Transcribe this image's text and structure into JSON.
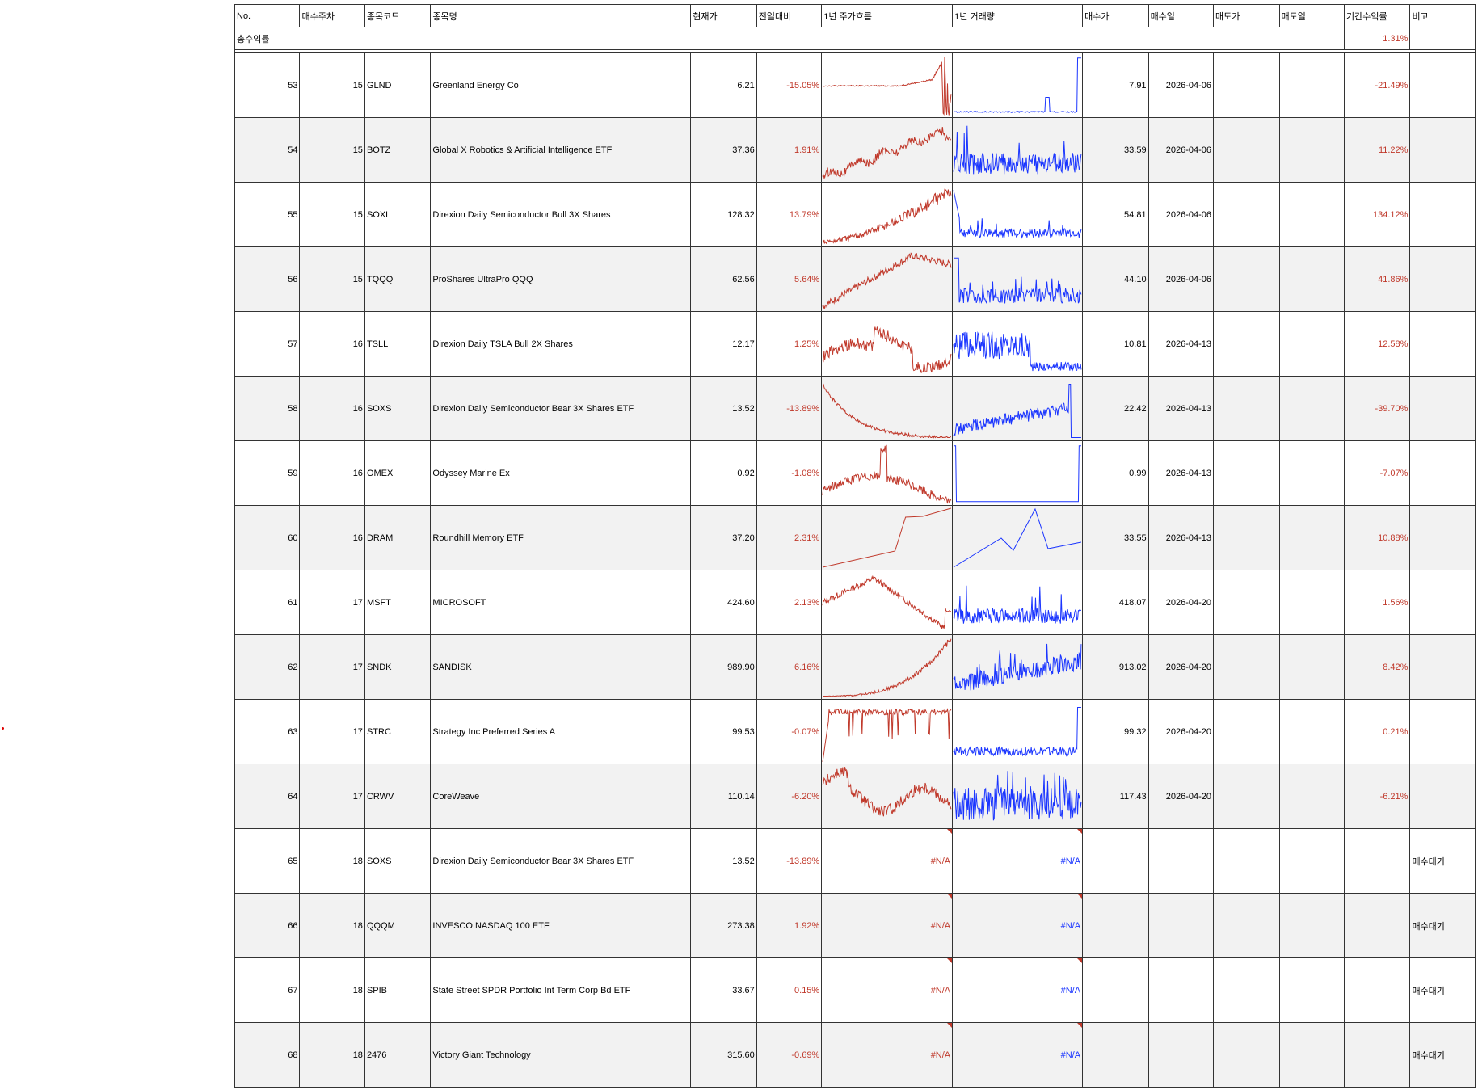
{
  "headers": [
    "No.",
    "매수주차",
    "종목코드",
    "종목명",
    "현재가",
    "전일대비",
    "1년 주가흐름",
    "1년 거래량",
    "매수가",
    "매수일",
    "매도가",
    "매도일",
    "기간수익률",
    "비고"
  ],
  "total": {
    "label": "총수익률",
    "return": "1.31%"
  },
  "colors": {
    "positive": "#c0392b",
    "negative": "#c0392b",
    "price_line": "#c0392b",
    "volume_line": "#1a35ff"
  },
  "rows": [
    {
      "no": "53",
      "week": "15",
      "code": "GLND",
      "name": "Greenland Energy Co",
      "price": "6.21",
      "change": "-15.05%",
      "buy_price": "7.91",
      "buy_date": "2026-04-06",
      "sell_price": "",
      "sell_date": "",
      "return": "-21.49%",
      "note": "",
      "spark": "glnd"
    },
    {
      "no": "54",
      "week": "15",
      "code": "BOTZ",
      "name": "Global X Robotics & Artificial Intelligence ETF",
      "price": "37.36",
      "change": "1.91%",
      "buy_price": "33.59",
      "buy_date": "2026-04-06",
      "sell_price": "",
      "sell_date": "",
      "return": "11.22%",
      "note": "",
      "spark": "uptrend"
    },
    {
      "no": "55",
      "week": "15",
      "code": "SOXL",
      "name": "Direxion Daily Semiconductor Bull 3X Shares",
      "price": "128.32",
      "change": "13.79%",
      "buy_price": "54.81",
      "buy_date": "2026-04-06",
      "sell_price": "",
      "sell_date": "",
      "return": "134.12%",
      "note": "",
      "spark": "soxl"
    },
    {
      "no": "56",
      "week": "15",
      "code": "TQQQ",
      "name": "ProShares UltraPro QQQ",
      "price": "62.56",
      "change": "5.64%",
      "buy_price": "44.10",
      "buy_date": "2026-04-06",
      "sell_price": "",
      "sell_date": "",
      "return": "41.86%",
      "note": "",
      "spark": "tqqq"
    },
    {
      "no": "57",
      "week": "16",
      "code": "TSLL",
      "name": "Direxion Daily TSLA Bull 2X Shares",
      "price": "12.17",
      "change": "1.25%",
      "buy_price": "10.81",
      "buy_date": "2026-04-13",
      "sell_price": "",
      "sell_date": "",
      "return": "12.58%",
      "note": "",
      "spark": "tsll"
    },
    {
      "no": "58",
      "week": "16",
      "code": "SOXS",
      "name": "Direxion Daily Semiconductor Bear 3X Shares ETF",
      "price": "13.52",
      "change": "-13.89%",
      "buy_price": "22.42",
      "buy_date": "2026-04-13",
      "sell_price": "",
      "sell_date": "",
      "return": "-39.70%",
      "note": "",
      "spark": "soxs"
    },
    {
      "no": "59",
      "week": "16",
      "code": "OMEX",
      "name": "Odyssey Marine Ex",
      "price": "0.92",
      "change": "-1.08%",
      "buy_price": "0.99",
      "buy_date": "2026-04-13",
      "sell_price": "",
      "sell_date": "",
      "return": "-7.07%",
      "note": "",
      "spark": "omex"
    },
    {
      "no": "60",
      "week": "16",
      "code": "DRAM",
      "name": "Roundhill Memory ETF",
      "price": "37.20",
      "change": "2.31%",
      "buy_price": "33.55",
      "buy_date": "2026-04-13",
      "sell_price": "",
      "sell_date": "",
      "return": "10.88%",
      "note": "",
      "spark": "dram"
    },
    {
      "no": "61",
      "week": "17",
      "code": "MSFT",
      "name": "MICROSOFT",
      "price": "424.60",
      "change": "2.13%",
      "buy_price": "418.07",
      "buy_date": "2026-04-20",
      "sell_price": "",
      "sell_date": "",
      "return": "1.56%",
      "note": "",
      "spark": "msft"
    },
    {
      "no": "62",
      "week": "17",
      "code": "SNDK",
      "name": "SANDISK",
      "price": "989.90",
      "change": "6.16%",
      "buy_price": "913.02",
      "buy_date": "2026-04-20",
      "sell_price": "",
      "sell_date": "",
      "return": "8.42%",
      "note": "",
      "spark": "sndk"
    },
    {
      "no": "63",
      "week": "17",
      "code": "STRC",
      "name": "Strategy Inc Preferred Series A",
      "price": "99.53",
      "change": "-0.07%",
      "buy_price": "99.32",
      "buy_date": "2026-04-20",
      "sell_price": "",
      "sell_date": "",
      "return": "0.21%",
      "note": "",
      "spark": "strc"
    },
    {
      "no": "64",
      "week": "17",
      "code": "CRWV",
      "name": "CoreWeave",
      "price": "110.14",
      "change": "-6.20%",
      "buy_price": "117.43",
      "buy_date": "2026-04-20",
      "sell_price": "",
      "sell_date": "",
      "return": "-6.21%",
      "note": "",
      "spark": "crwv"
    },
    {
      "no": "65",
      "week": "18",
      "code": "SOXS",
      "name": "Direxion Daily Semiconductor Bear 3X Shares ETF",
      "price": "13.52",
      "change": "-13.89%",
      "buy_price": "",
      "buy_date": "",
      "sell_price": "",
      "sell_date": "",
      "return": "",
      "note": "매수대기",
      "spark": "na",
      "na_text": "#N/A"
    },
    {
      "no": "66",
      "week": "18",
      "code": "QQQM",
      "name": "INVESCO NASDAQ 100 ETF",
      "price": "273.38",
      "change": "1.92%",
      "buy_price": "",
      "buy_date": "",
      "sell_price": "",
      "sell_date": "",
      "return": "",
      "note": "매수대기",
      "spark": "na",
      "na_text": "#N/A"
    },
    {
      "no": "67",
      "week": "18",
      "code": "SPIB",
      "name": "State Street SPDR Portfolio Int Term Corp Bd ETF",
      "price": "33.67",
      "change": "0.15%",
      "buy_price": "",
      "buy_date": "",
      "sell_price": "",
      "sell_date": "",
      "return": "",
      "note": "매수대기",
      "spark": "na",
      "na_text": "#N/A"
    },
    {
      "no": "68",
      "week": "18",
      "code": "2476",
      "name": "Victory Giant Technology",
      "price": "315.60",
      "change": "-0.69%",
      "buy_price": "",
      "buy_date": "",
      "sell_price": "",
      "sell_date": "",
      "return": "",
      "note": "매수대기",
      "spark": "na",
      "na_text": "#N/A"
    }
  ]
}
